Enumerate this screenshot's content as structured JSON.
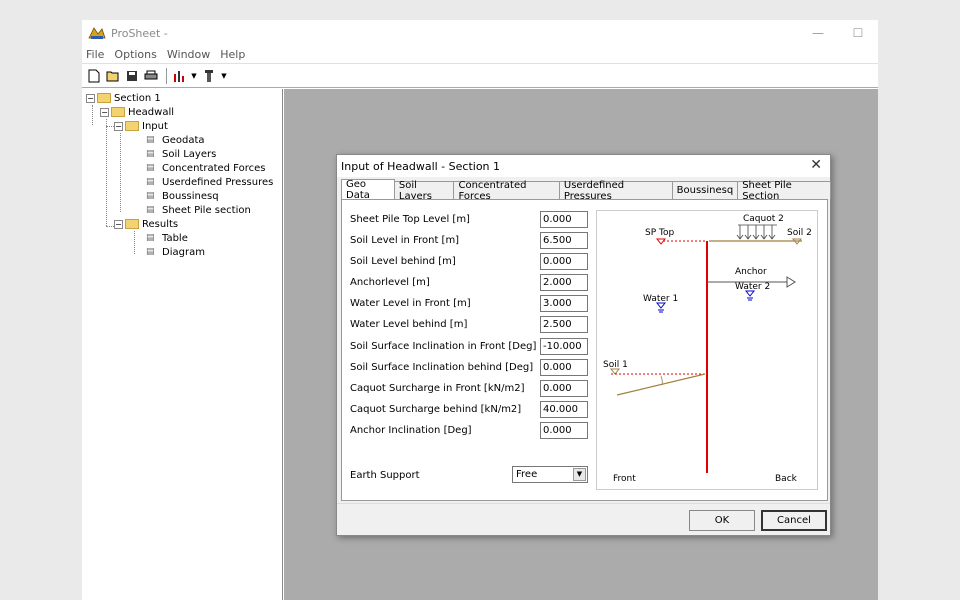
{
  "app": {
    "title": "ProSheet -",
    "minimize": "—",
    "maximize": "☐"
  },
  "menu": [
    "File",
    "Options",
    "Window",
    "Help"
  ],
  "tree": {
    "section": "Section 1",
    "headwall": "Headwall",
    "input": "Input",
    "input_items": [
      "Geodata",
      "Soil Layers",
      "Concentrated Forces",
      "Userdefined Pressures",
      "Boussinesq",
      "Sheet Pile section"
    ],
    "results": "Results",
    "results_items": [
      "Table",
      "Diagram"
    ]
  },
  "dialog": {
    "title": "Input of Headwall - Section 1",
    "tabs": [
      "Geo Data",
      "Soil Layers",
      "Concentrated Forces",
      "Userdefined Pressures",
      "Boussinesq",
      "Sheet Pile Section"
    ],
    "fields": [
      {
        "label": "Sheet Pile Top Level [m]",
        "value": "0.000"
      },
      {
        "label": "Soil Level in Front [m]",
        "value": "6.500"
      },
      {
        "label": "Soil Level behind [m]",
        "value": "0.000"
      },
      {
        "label": "Anchorlevel [m]",
        "value": "2.000"
      },
      {
        "label": "Water Level in Front [m]",
        "value": "3.000"
      },
      {
        "label": "Water Level behind [m]",
        "value": "2.500"
      },
      {
        "label": "Soil Surface Inclination in Front  [Deg]",
        "value": "-10.000"
      },
      {
        "label": "Soil Surface Inclination behind [Deg]",
        "value": "0.000"
      },
      {
        "label": "Caquot Surcharge in Front [kN/m2]",
        "value": "0.000"
      },
      {
        "label": "Caquot Surcharge behind [kN/m2]",
        "value": "40.000"
      },
      {
        "label": "Anchor Inclination [Deg]",
        "value": "0.000"
      }
    ],
    "earth_support_label": "Earth Support",
    "earth_support_value": "Free",
    "diagram": {
      "sp_top": "SP Top",
      "caquot2": "Caquot 2",
      "soil2": "Soil 2",
      "anchor": "Anchor",
      "water2": "Water 2",
      "water1": "Water 1",
      "soil1": "Soil 1",
      "front": "Front",
      "back": "Back"
    },
    "ok_label": "OK",
    "cancel_label": "Cancel"
  },
  "colors": {
    "pile": "#e00000",
    "water": "#0000cc",
    "soil": "#a08040",
    "folder": "#f3d271"
  }
}
